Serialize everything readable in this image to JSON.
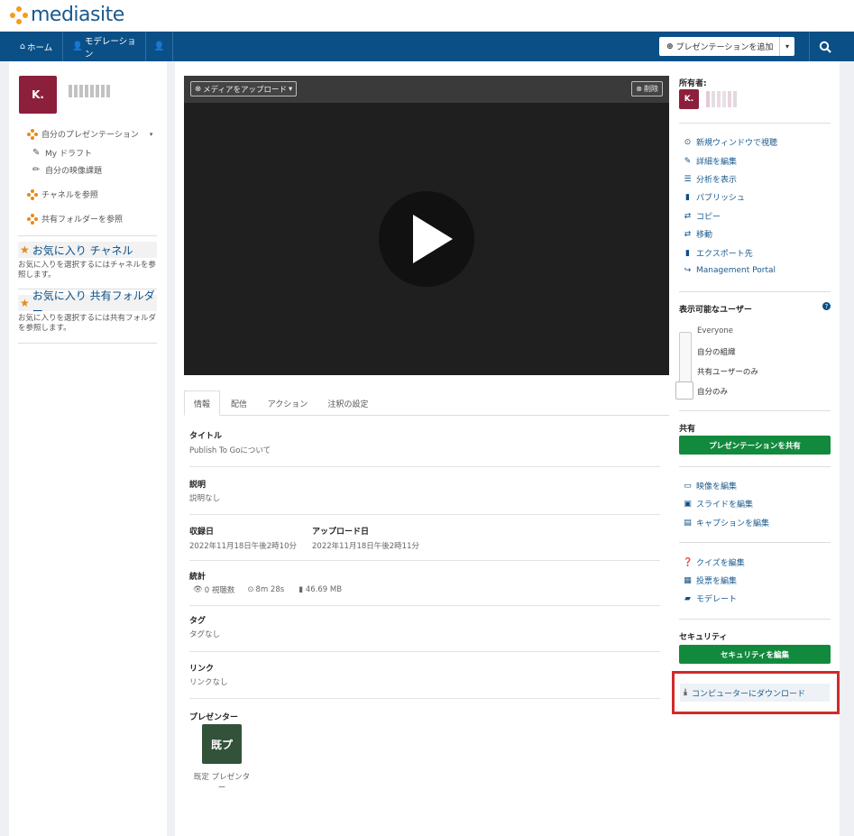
{
  "brand": {
    "name": "mediasite"
  },
  "nav": {
    "home": "ホーム",
    "moderation": "モデレーション",
    "add_presentation": "プレゼンテーションを追加"
  },
  "left": {
    "avatar_initial": "K.",
    "items": [
      {
        "label": "自分のプレゼンテーション"
      },
      {
        "label": "My ドラフト"
      },
      {
        "label": "自分の映像課題"
      },
      {
        "label": "チャネルを参照"
      },
      {
        "label": "共有フォルダーを参照"
      }
    ],
    "fav_channel_title": "お気に入り チャネル",
    "fav_channel_desc": "お気に入りを選択するにはチャネルを参照します。",
    "fav_folder_title": "お気に入り 共有フォルダー",
    "fav_folder_desc": "お気に入りを選択するには共有フォルダを参照します。"
  },
  "player": {
    "upload_label": "メディアをアップロード",
    "delete_label": "削除"
  },
  "tabs": [
    "情報",
    "配信",
    "アクション",
    "注釈の設定"
  ],
  "info": {
    "title_label": "タイトル",
    "title_value": "Publish To Goについて",
    "desc_label": "説明",
    "desc_value": "説明なし",
    "recorded_label": "収録日",
    "recorded_value": "2022年11月18日午後2時10分",
    "uploaded_label": "アップロード日",
    "uploaded_value": "2022年11月18日午後2時11分",
    "stats_label": "統計",
    "stats_views": "0 視聴数",
    "stats_duration": "8m 28s",
    "stats_size": "46.69 MB",
    "tags_label": "タグ",
    "tags_value": "タグなし",
    "links_label": "リンク",
    "links_value": "リンクなし",
    "presenter_label": "プレゼンター",
    "presenter_initial": "既プ",
    "presenter_name": "既定 プレゼンター"
  },
  "right": {
    "owner_label": "所有者:",
    "owner_initial": "K.",
    "actions": [
      {
        "label": "新規ウィンドウで視聴"
      },
      {
        "label": "詳細を編集"
      },
      {
        "label": "分析を表示"
      },
      {
        "label": "パブリッシュ"
      },
      {
        "label": "コピー"
      },
      {
        "label": "移動"
      },
      {
        "label": "エクスポート先"
      },
      {
        "label": "Management Portal"
      }
    ],
    "visibility_label": "表示可能なユーザー",
    "visibility": [
      "Everyone",
      "自分の組織",
      "共有ユーザーのみ",
      "自分のみ"
    ],
    "share_label": "共有",
    "share_button": "プレゼンテーションを共有",
    "edit_items": [
      {
        "label": "映像を編集"
      },
      {
        "label": "スライドを編集"
      },
      {
        "label": "キャプションを編集"
      }
    ],
    "quiz_items": [
      {
        "label": "クイズを編集"
      },
      {
        "label": "投票を編集"
      },
      {
        "label": "モデレート"
      }
    ],
    "security_label": "セキュリティ",
    "security_button": "セキュリティを編集",
    "download_label": "コンピューターにダウンロード"
  }
}
